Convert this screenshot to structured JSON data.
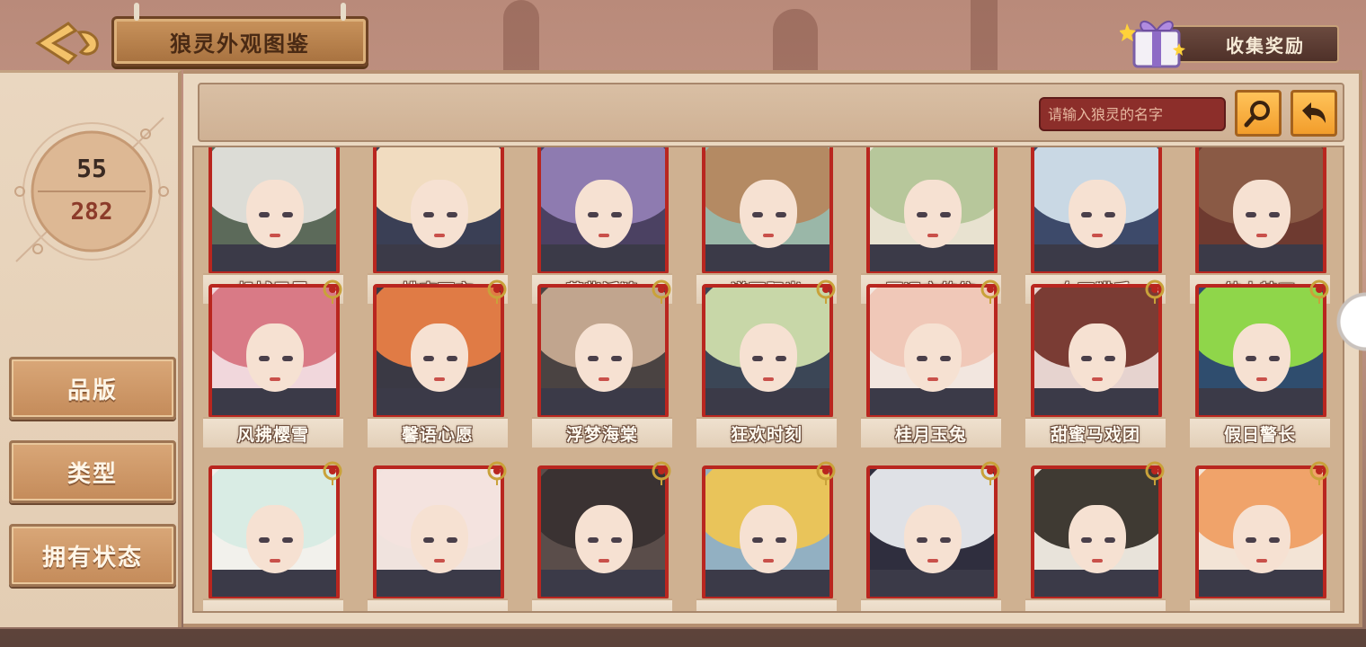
{
  "header": {
    "title": "狼灵外观图鉴",
    "reward_label": "收集奖励"
  },
  "sidebar": {
    "collected": "55",
    "total": "282",
    "filters": [
      {
        "label": "品版"
      },
      {
        "label": "类型"
      },
      {
        "label": "拥有状态"
      }
    ]
  },
  "search": {
    "placeholder": "请输入狼灵的名字",
    "search_icon": "magnifier-icon",
    "back_icon": "return-arrow-icon"
  },
  "colors": {
    "accent_orange": "#f29d2b",
    "frame_red": "#b9261f",
    "panel_beige": "#ead8c1"
  },
  "cards": [
    {
      "name": "机械风暴",
      "hair": "#dcdcd6",
      "bg": "#5c6a5a"
    },
    {
      "name": "桃李不言",
      "hair": "#f1dcc0",
      "bg": "#3a3f55"
    },
    {
      "name": "落紫泛涟",
      "hair": "#8e7bb0",
      "bg": "#4b4162"
    },
    {
      "name": "谱写阳光",
      "hair": "#b48a63",
      "bg": "#9ab7a8"
    },
    {
      "name": "至远方的信",
      "hair": "#b7c79b",
      "bg": "#e8e2d0"
    },
    {
      "name": "女巫猎手",
      "hair": "#c9d8e4",
      "bg": "#3d4a6a"
    },
    {
      "name": "绅士特工",
      "hair": "#8a5a45",
      "bg": "#6e3a30"
    },
    {
      "name": "风拂樱雪",
      "hair": "#d97a86",
      "bg": "#f1d7dc"
    },
    {
      "name": "馨语心愿",
      "hair": "#e07b45",
      "bg": "#3a3944"
    },
    {
      "name": "浮梦海棠",
      "hair": "#c1a58e",
      "bg": "#4a4342"
    },
    {
      "name": "狂欢时刻",
      "hair": "#c8d7a8",
      "bg": "#3b4656"
    },
    {
      "name": "桂月玉兔",
      "hair": "#f0c8b8",
      "bg": "#f2e6df"
    },
    {
      "name": "甜蜜马戏团",
      "hair": "#7a3c34",
      "bg": "#e6d3cf"
    },
    {
      "name": "假日警长",
      "hair": "#8fd64a",
      "bg": "#2f4d6e"
    },
    {
      "name": "",
      "hair": "#d9ece4",
      "bg": "#f2f1ec"
    },
    {
      "name": "",
      "hair": "#f4e3df",
      "bg": "#f0e3de"
    },
    {
      "name": "",
      "hair": "#3a3232",
      "bg": "#5a4d4a"
    },
    {
      "name": "",
      "hair": "#e9c45a",
      "bg": "#92b0c2"
    },
    {
      "name": "",
      "hair": "#dfe1e6",
      "bg": "#2f2e3e"
    },
    {
      "name": "",
      "hair": "#3f3a33",
      "bg": "#e8e3da"
    },
    {
      "name": "",
      "hair": "#f0a36a",
      "bg": "#f3e4d6"
    }
  ]
}
